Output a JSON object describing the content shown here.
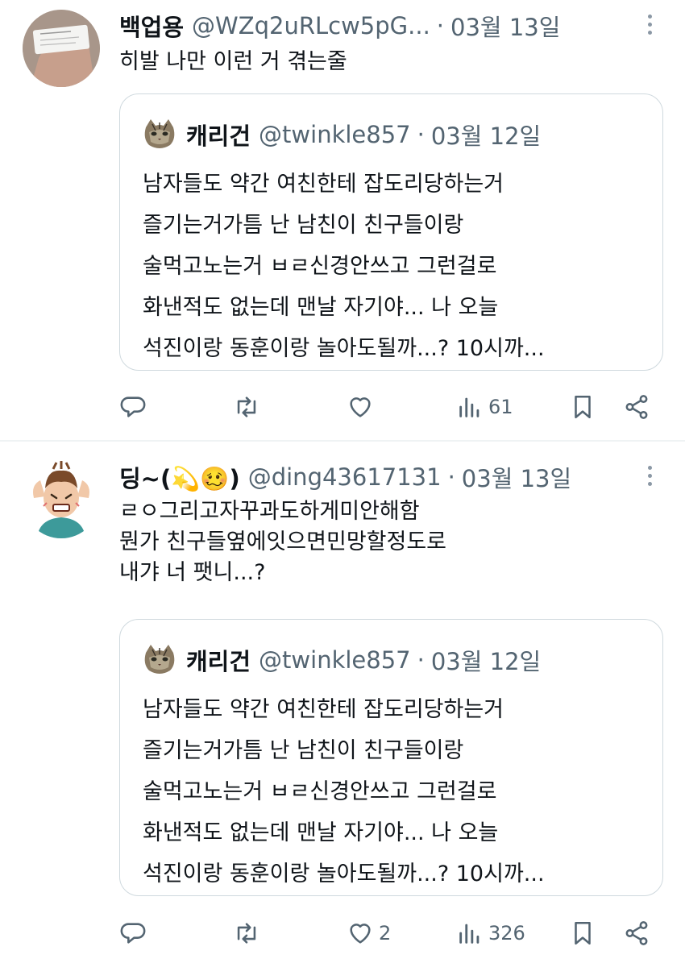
{
  "tweets": [
    {
      "author_name": "백업용",
      "handle": "@WZq2uRLcw5pG...",
      "dot": "·",
      "date": "03월 13일",
      "text_lines": [
        "히발 나만 이런 거 겪는줄"
      ],
      "quote": {
        "author_name": "캐리건",
        "handle": "@twinkle857",
        "dot": "·",
        "date": "03월 12일",
        "text_lines": [
          "남자들도 약간 여친한테 잡도리당하는거",
          "즐기는거가틈 난 남친이 친구들이랑",
          "술먹고노는거 ㅂㄹ신경안쓰고 그런걸로",
          "화낸적도 없는데 맨날 자기야... 나 오늘",
          "석진이랑 동훈이랑 놀아도될까...? 10시까..."
        ]
      },
      "actions": {
        "reply_count": "",
        "retweet_count": "",
        "like_count": "",
        "view_count": "61"
      }
    },
    {
      "author_name": "딩~(💫🥴)",
      "handle": "@ding43617131",
      "dot": "·",
      "date": "03월 13일",
      "text_lines": [
        "ㄹㅇ그리고자꾸과도하게미안해함",
        "뭔가 친구들옆에잇으면민망할정도로",
        "내갸 너 팻니...?"
      ],
      "quote": {
        "author_name": "캐리건",
        "handle": "@twinkle857",
        "dot": "·",
        "date": "03월 12일",
        "text_lines": [
          "남자들도 약간 여친한테 잡도리당하는거",
          "즐기는거가틈 난 남친이 친구들이랑",
          "술먹고노는거 ㅂㄹ신경안쓰고 그런걸로",
          "화낸적도 없는데 맨날 자기야... 나 오늘",
          "석진이랑 동훈이랑 놀아도될까...? 10시까..."
        ]
      },
      "actions": {
        "reply_count": "",
        "retweet_count": "",
        "like_count": "2",
        "view_count": "326"
      }
    }
  ],
  "icons": {
    "reply": "reply-icon",
    "retweet": "retweet-icon",
    "like": "heart-icon",
    "views": "views-icon",
    "bookmark": "bookmark-icon",
    "share": "share-icon",
    "more": "more-icon"
  },
  "colors": {
    "text": "#0f1419",
    "secondary": "#536471",
    "border": "#cfd9de"
  }
}
